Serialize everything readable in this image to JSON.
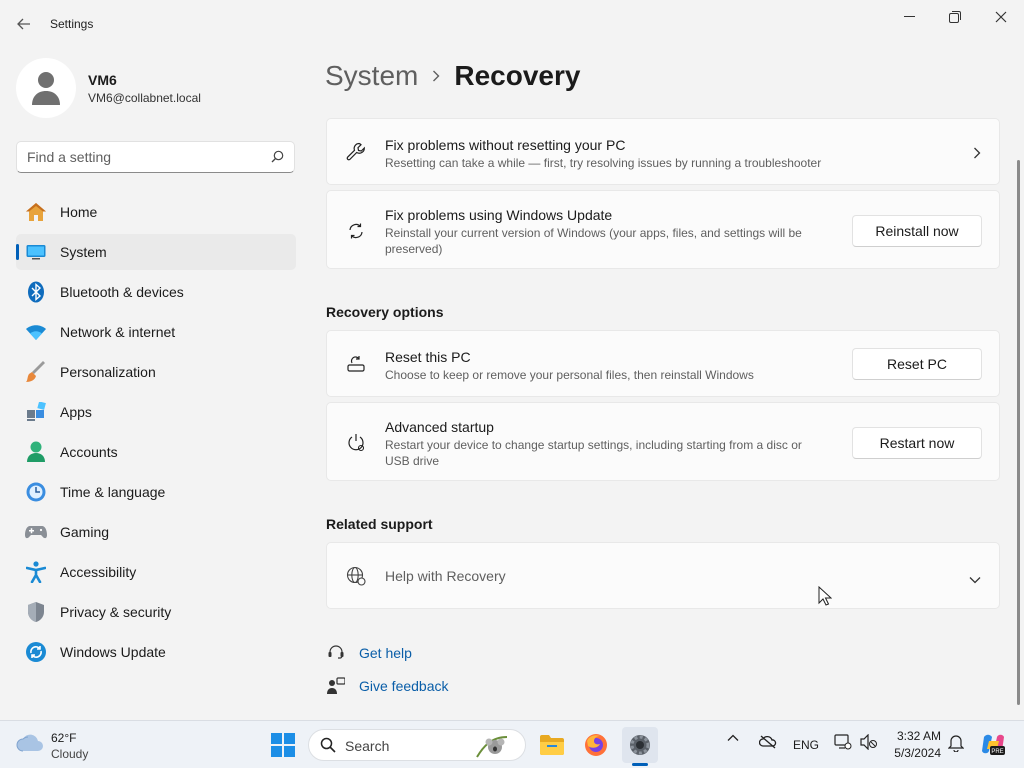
{
  "app": {
    "title": "Settings"
  },
  "profile": {
    "name": "VM6",
    "email": "VM6@collabnet.local"
  },
  "search": {
    "placeholder": "Find a setting"
  },
  "sidebar": {
    "items": [
      {
        "label": "Home",
        "icon": "home-icon"
      },
      {
        "label": "System",
        "icon": "system-icon",
        "active": true
      },
      {
        "label": "Bluetooth & devices",
        "icon": "bluetooth-icon"
      },
      {
        "label": "Network & internet",
        "icon": "wifi-icon"
      },
      {
        "label": "Personalization",
        "icon": "brush-icon"
      },
      {
        "label": "Apps",
        "icon": "apps-icon"
      },
      {
        "label": "Accounts",
        "icon": "accounts-icon"
      },
      {
        "label": "Time & language",
        "icon": "clock-globe-icon"
      },
      {
        "label": "Gaming",
        "icon": "gamepad-icon"
      },
      {
        "label": "Accessibility",
        "icon": "accessibility-icon"
      },
      {
        "label": "Privacy & security",
        "icon": "shield-icon"
      },
      {
        "label": "Windows Update",
        "icon": "update-icon"
      }
    ]
  },
  "breadcrumb": {
    "parent": "System",
    "current": "Recovery"
  },
  "cards": {
    "fix_problems": {
      "title": "Fix problems without resetting your PC",
      "desc": "Resetting can take a while — first, try resolving issues by running a troubleshooter"
    },
    "windows_update": {
      "title": "Fix problems using Windows Update",
      "desc_line1": "Reinstall your current version of Windows (your apps, files, and settings will be",
      "desc_line2": "preserved)",
      "button": "Reinstall now"
    },
    "reset_pc": {
      "title": "Reset this PC",
      "desc": "Choose to keep or remove your personal files, then reinstall Windows",
      "button": "Reset PC"
    },
    "advanced_startup": {
      "title": "Advanced startup",
      "desc_line1": "Restart your device to change startup settings, including starting from a disc or",
      "desc_line2": "USB drive",
      "button": "Restart now"
    },
    "help_recovery": {
      "title": "Help with Recovery"
    }
  },
  "sections": {
    "recovery_options": "Recovery options",
    "related_support": "Related support"
  },
  "links": {
    "get_help": "Get help",
    "give_feedback": "Give feedback"
  },
  "taskbar": {
    "weather": {
      "temp": "62°F",
      "condition": "Cloudy"
    },
    "search_label": "Search",
    "language": "ENG",
    "time": "3:32 AM",
    "date": "5/3/2024",
    "copilot_badge": "PRE"
  },
  "colors": {
    "accent": "#005fb8",
    "link": "#0a5ea8"
  }
}
